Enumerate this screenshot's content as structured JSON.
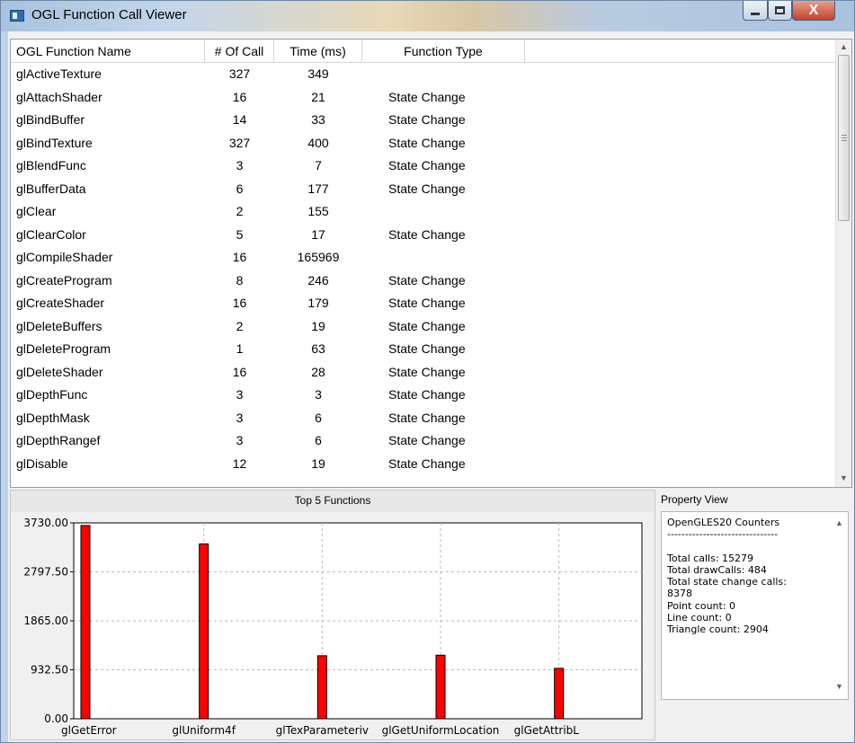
{
  "window": {
    "title": "OGL Function Call Viewer",
    "close_glyph": "X"
  },
  "table": {
    "columns": [
      "OGL Function Name",
      "# Of Call",
      "Time (ms)",
      "Function Type"
    ],
    "rows": [
      [
        "glActiveTexture",
        "327",
        "349",
        ""
      ],
      [
        "glAttachShader",
        "16",
        "21",
        "State Change"
      ],
      [
        "glBindBuffer",
        "14",
        "33",
        "State Change"
      ],
      [
        "glBindTexture",
        "327",
        "400",
        "State Change"
      ],
      [
        "glBlendFunc",
        "3",
        "7",
        "State Change"
      ],
      [
        "glBufferData",
        "6",
        "177",
        "State Change"
      ],
      [
        "glClear",
        "2",
        "155",
        ""
      ],
      [
        "glClearColor",
        "5",
        "17",
        "State Change"
      ],
      [
        "glCompileShader",
        "16",
        "165969",
        ""
      ],
      [
        "glCreateProgram",
        "8",
        "246",
        "State Change"
      ],
      [
        "glCreateShader",
        "16",
        "179",
        "State Change"
      ],
      [
        "glDeleteBuffers",
        "2",
        "19",
        "State Change"
      ],
      [
        "glDeleteProgram",
        "1",
        "63",
        "State Change"
      ],
      [
        "glDeleteShader",
        "16",
        "28",
        "State Change"
      ],
      [
        "glDepthFunc",
        "3",
        "3",
        "State Change"
      ],
      [
        "glDepthMask",
        "3",
        "6",
        "State Change"
      ],
      [
        "glDepthRangef",
        "3",
        "6",
        "State Change"
      ],
      [
        "glDisable",
        "12",
        "19",
        "State Change"
      ]
    ]
  },
  "chart_data": {
    "type": "bar",
    "title": "Top 5 Functions",
    "categories": [
      "glGetError",
      "glUniform4f",
      "glTexParameteriv",
      "glGetUniformLocation",
      "glGetAttribL"
    ],
    "values": [
      3680,
      3330,
      1200,
      1210,
      960
    ],
    "y_ticks": [
      "3730.00",
      "2797.50",
      "1865.00",
      "932.50",
      "0.00"
    ],
    "ylim": [
      0,
      3730
    ],
    "grid": true,
    "bar_color": "#ff0000"
  },
  "property_view": {
    "title": "Property View",
    "lines": [
      "OpenGLES20 Counters",
      "-------------------------------",
      "",
      "Total calls: 15279",
      "Total drawCalls: 484",
      "Total state change calls:",
      "8378",
      "Point count: 0",
      "Line count: 0",
      "Triangle count: 2904"
    ]
  },
  "icons": {
    "scroll_up": "▲",
    "scroll_down": "▼"
  }
}
